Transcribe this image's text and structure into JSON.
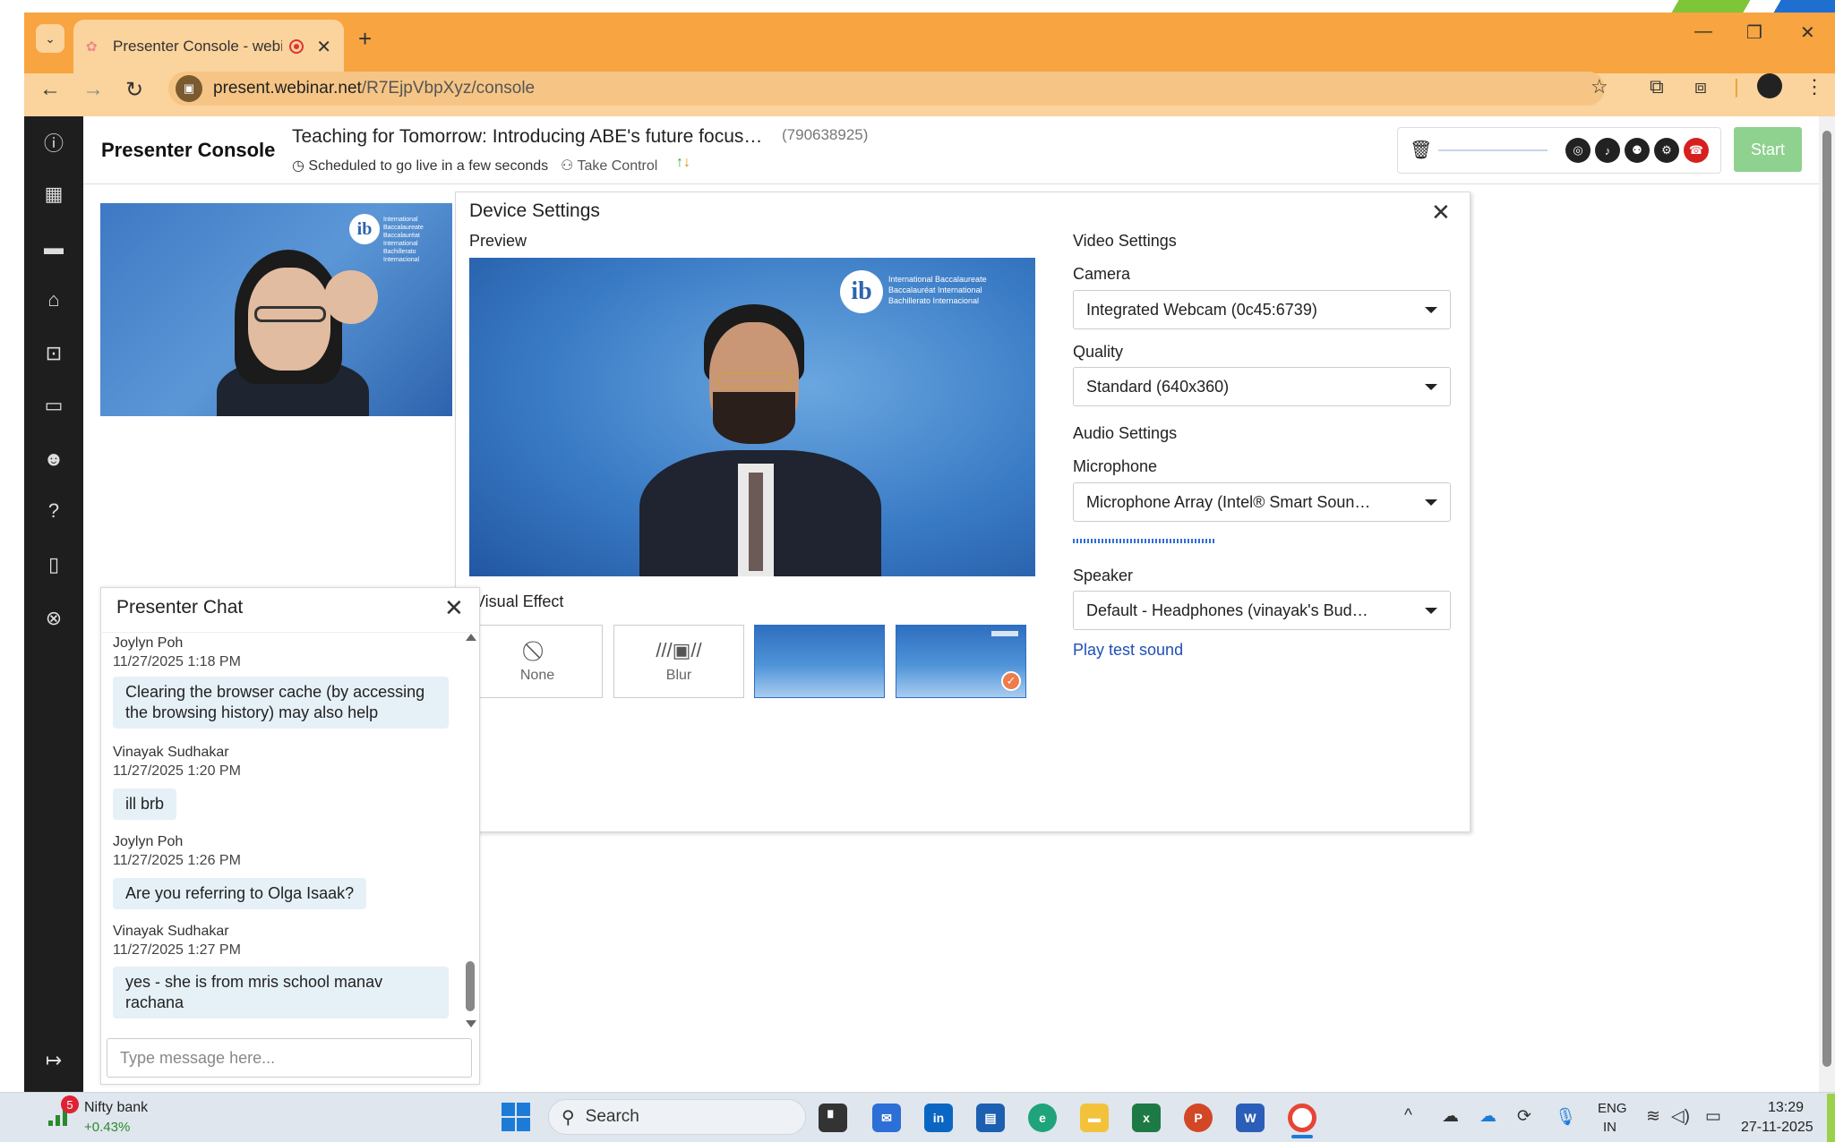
{
  "browser": {
    "tab_title": "Presenter Console - webinar",
    "url_host": "present.webinar.net",
    "url_path": "/R7EjpVbpXyz/console",
    "new_tab": "+",
    "tab_close": "✕"
  },
  "header": {
    "presenter_console": "Presenter Console",
    "webinar_title": "Teaching for Tomorrow: Introducing ABE's future focus…",
    "webinar_id": "(790638925)",
    "schedule": "Scheduled to go live in a few seconds",
    "take_control": "Take Control",
    "start_label": "Start"
  },
  "webcam_logo": {
    "letter": "ib",
    "line1": "International Baccalaureate",
    "line2": "Baccalauréat International",
    "line3": "Bachillerato Internacional"
  },
  "device_settings": {
    "title": "Device Settings",
    "preview_label": "Preview",
    "visual_effect_label": "Visual Effect",
    "effects": [
      {
        "label": "None",
        "icon": "⃠"
      },
      {
        "label": "Blur",
        "icon": "///▣//"
      }
    ],
    "video_settings": "Video Settings",
    "camera_label": "Camera",
    "camera_value": "Integrated Webcam (0c45:6739)",
    "quality_label": "Quality",
    "quality_value": "Standard (640x360)",
    "audio_settings": "Audio Settings",
    "microphone_label": "Microphone",
    "microphone_value": "Microphone Array (Intel® Smart Soun…",
    "speaker_label": "Speaker",
    "speaker_value": "Default - Headphones (vinayak's Bud…",
    "play_test_sound": "Play test sound"
  },
  "chat": {
    "title": "Presenter Chat",
    "input_placeholder": "Type message here...",
    "messages": [
      {
        "author": "Joylyn Poh",
        "time": "11/27/2025 1:18 PM",
        "text1": "Clearing the browser cache (by accessing",
        "text2": "the browsing history) may also help"
      },
      {
        "author": "Vinayak Sudhakar",
        "time": "11/27/2025 1:20 PM",
        "text1": "ill brb",
        "text2": ""
      },
      {
        "author": "Joylyn Poh",
        "time": "11/27/2025 1:26 PM",
        "text1": "Are you referring to Olga Isaak?",
        "text2": ""
      },
      {
        "author": "Vinayak Sudhakar",
        "time": "11/27/2025 1:27 PM",
        "text1": "yes - she is from mris school manav",
        "text2": "rachana"
      }
    ]
  },
  "taskbar": {
    "nifty_badge": "5",
    "nifty_name": "Nifty bank",
    "nifty_change": "+0.43%",
    "search": "Search",
    "lang1": "ENG",
    "lang2": "IN",
    "time": "13:29",
    "date": "27-11-2025"
  },
  "colors": {
    "tabbar": "#f8a440",
    "toolbar": "#fbd39c",
    "sidebar": "#1e1e1e",
    "start_button": "#8fd18f",
    "link": "#1f4fb8",
    "chat_bubble": "#e6f0f7"
  },
  "icons": {
    "sidebar": [
      "info-icon",
      "grid-icon",
      "folder-icon",
      "presentation-icon",
      "presenter-screen-icon",
      "chat-icon",
      "users-icon",
      "question-icon",
      "layout-icon",
      "support-icon",
      "logout-icon"
    ]
  }
}
